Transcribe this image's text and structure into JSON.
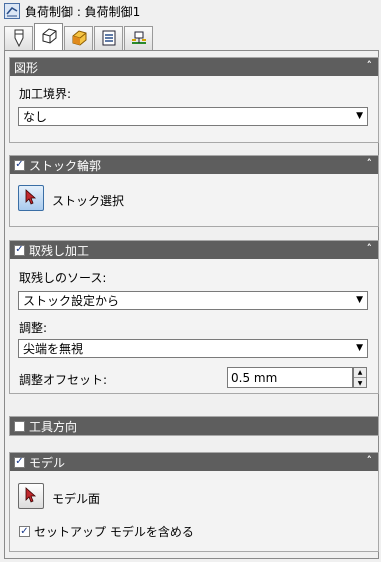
{
  "window": {
    "title": "負荷制御 : 負荷制御1"
  },
  "tabs": [
    {
      "icon": "tool-icon"
    },
    {
      "icon": "geometry-icon",
      "active": true
    },
    {
      "icon": "heights-icon"
    },
    {
      "icon": "passes-icon"
    },
    {
      "icon": "linking-icon"
    }
  ],
  "groups": {
    "geometry": {
      "title": "図形",
      "boundary_label": "加工境界:",
      "boundary_value": "なし"
    },
    "stock_contour": {
      "title": "ストック輪郭",
      "checked": true,
      "select_label": "ストック選択"
    },
    "rest_machining": {
      "title": "取残し加工",
      "checked": true,
      "source_label": "取残しのソース:",
      "source_value": "ストック設定から",
      "adjust_label": "調整:",
      "adjust_value": "尖端を無視",
      "offset_label": "調整オフセット:",
      "offset_value": "0.5 mm"
    },
    "tool_orientation": {
      "title": "工具方向",
      "checked": false
    },
    "model": {
      "title": "モデル",
      "checked": true,
      "faces_label": "モデル面",
      "include_setup_label": "セットアップ モデルを含める",
      "include_setup_checked": true
    }
  },
  "colors": {
    "header_bg": "#5e5e5e",
    "accent": "#3a6ea5"
  }
}
